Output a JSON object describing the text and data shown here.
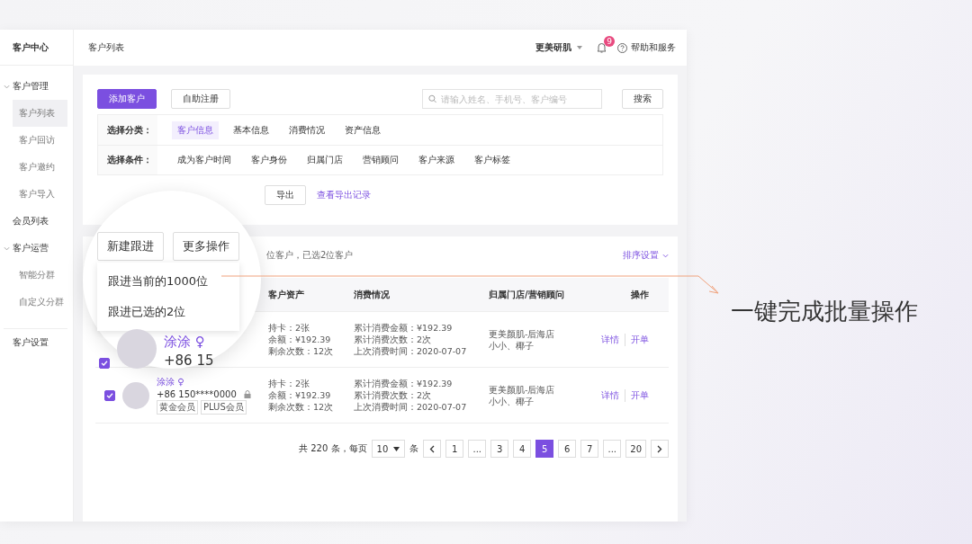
{
  "sidebar": {
    "title": "客户中心",
    "items": [
      {
        "label": "客户管理",
        "expanded": true,
        "children": [
          {
            "label": "客户列表",
            "selected": true
          },
          {
            "label": "客户回访",
            "selected": false
          },
          {
            "label": "客户邀约",
            "selected": false
          },
          {
            "label": "客户导入",
            "selected": false
          }
        ]
      },
      {
        "label": "会员列表",
        "selected": false
      },
      {
        "label": "客户运营",
        "expanded": true,
        "children": [
          {
            "label": "智能分群",
            "selected": false
          },
          {
            "label": "自定义分群",
            "selected": false
          }
        ]
      },
      {
        "label": "客户设置",
        "selected": false,
        "separated": true
      }
    ]
  },
  "header": {
    "breadcrumb": "客户列表",
    "organization": "更美研肌",
    "notification_count": "9",
    "help": "帮助和服务"
  },
  "toolbar": {
    "buttons": [
      {
        "label": "添加客户",
        "kind": "primary"
      },
      {
        "label": "自助注册",
        "kind": "default"
      }
    ],
    "search": {
      "placeholder": "请输入姓名、手机号、客户编号",
      "button": "搜索"
    }
  },
  "filters": [
    {
      "label": "选择分类：",
      "options": [
        {
          "label": "客户信息",
          "selected": true
        },
        {
          "label": "基本信息",
          "selected": false
        },
        {
          "label": "消费情况",
          "selected": false
        },
        {
          "label": "资产信息",
          "selected": false
        }
      ]
    },
    {
      "label": "选择条件：",
      "options": [
        {
          "label": "成为客户时间",
          "selected": false
        },
        {
          "label": "客户身份",
          "selected": false
        },
        {
          "label": "归属门店",
          "selected": false
        },
        {
          "label": "营销顾问",
          "selected": false
        },
        {
          "label": "客户来源",
          "selected": false
        },
        {
          "label": "客户标签",
          "selected": false
        }
      ]
    }
  ],
  "export": {
    "button": "导出",
    "link": "查看导出记录"
  },
  "list": {
    "summary": "位客户，已选2位客户",
    "sort": "排序设置",
    "columns": [
      "",
      "客户资产",
      "消费情况",
      "归属门店/营销顾问",
      "操作"
    ],
    "rows": [
      {
        "customer": null,
        "assets": [
          "持卡：2张",
          "余额：¥192.39",
          "剩余次数：12次"
        ],
        "consumption": [
          "累计消费金额：¥192.39",
          "累计消费次数：2次",
          "上次消费时间：2020-07-07"
        ],
        "store": [
          "更美颜肌-后海店",
          "小小、椰子"
        ],
        "actions": [
          "详情",
          "开单"
        ]
      },
      {
        "customer": {
          "checked": true,
          "name": "涂涂",
          "gender": "♀",
          "phone": "+86 150****0000",
          "tags": [
            "黄金会员",
            "PLUS会员"
          ]
        },
        "assets": [
          "持卡：2张",
          "余额：¥192.39",
          "剩余次数：12次"
        ],
        "consumption": [
          "累计消费金额：¥192.39",
          "累计消费次数：2次",
          "上次消费时间：2020-07-07"
        ],
        "store": [
          "更美颜肌-后海店",
          "小小、椰子"
        ],
        "actions": [
          "详情",
          "开单"
        ]
      }
    ]
  },
  "pagination": {
    "total": "共 220 条，每页",
    "page_size": "10",
    "unit": "条",
    "pages": [
      {
        "label": "1",
        "selected": false
      },
      {
        "label": "...",
        "selected": false
      },
      {
        "label": "3",
        "selected": false
      },
      {
        "label": "4",
        "selected": false
      },
      {
        "label": "5",
        "selected": true
      },
      {
        "label": "6",
        "selected": false
      },
      {
        "label": "7",
        "selected": false
      },
      {
        "label": "...",
        "selected": false
      },
      {
        "label": "20",
        "selected": false
      }
    ]
  },
  "magnifier": {
    "buttons": [
      "新建跟进",
      "更多操作"
    ],
    "menu": [
      "跟进当前的1000位",
      "跟进已选的2位"
    ],
    "customer": {
      "checked": true,
      "name": "涂涂",
      "gender": "♀",
      "phone": "+86 15"
    }
  },
  "callout": "一键完成批量操作"
}
